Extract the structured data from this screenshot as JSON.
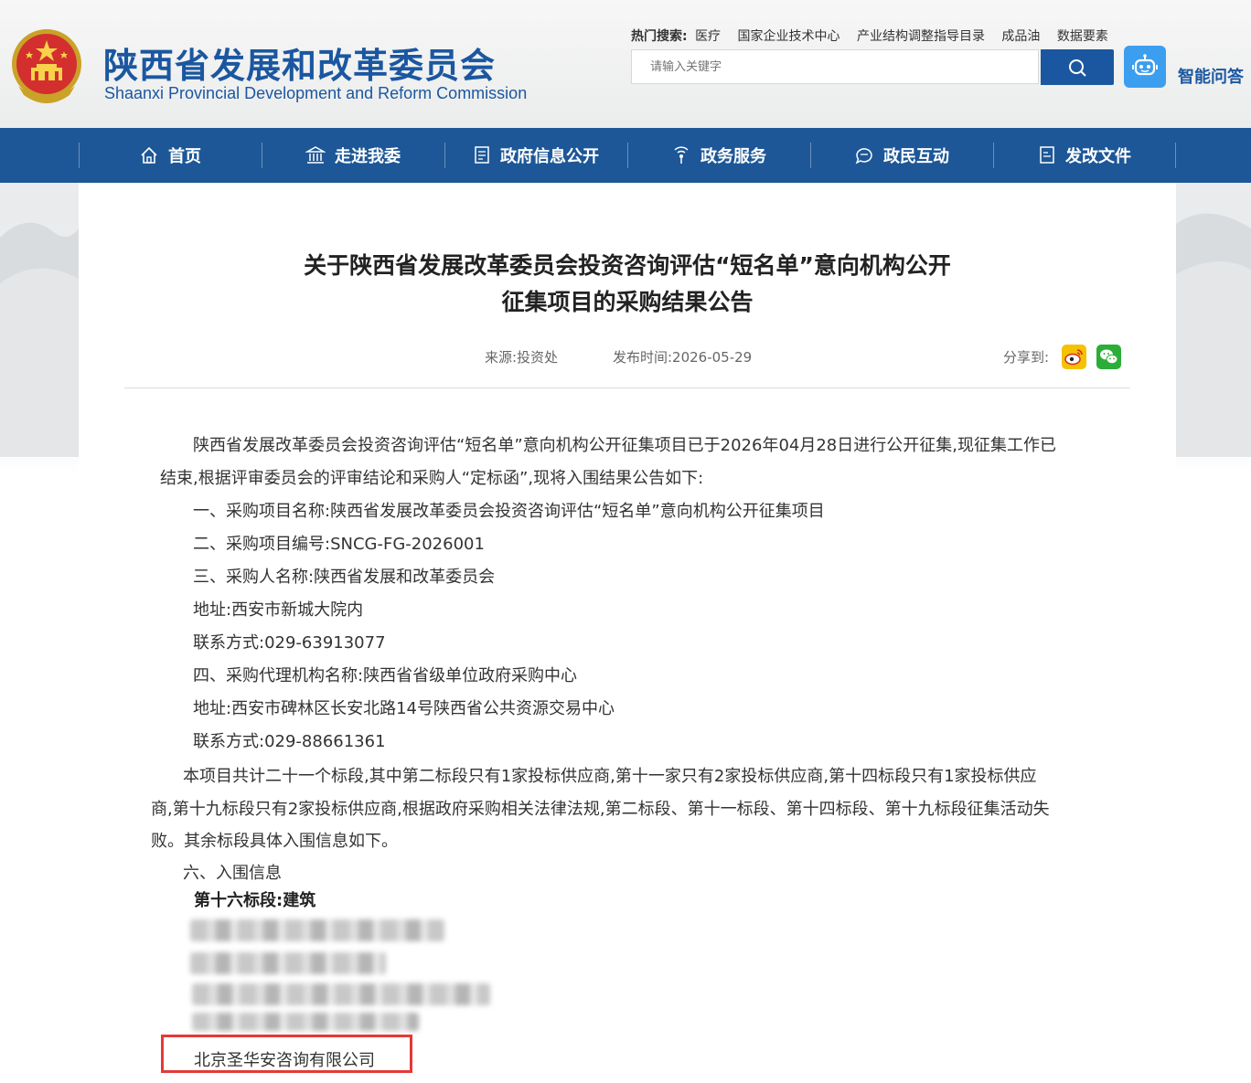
{
  "header": {
    "title_cn": "陕西省发展和改革委员会",
    "title_en": "Shaanxi Provincial Development and Reform Commission",
    "emblem_icon": "national-emblem-icon",
    "hot_search_label": "热门搜索:",
    "hot_search_items": [
      "医疗",
      "国家企业技术中心",
      "产业结构调整指导目录",
      "成品油",
      "数据要素"
    ],
    "search_placeholder": "请输入关键字",
    "smart_qa_label": "智能问答"
  },
  "nav": {
    "items": [
      {
        "label": "首页",
        "icon": "home-icon"
      },
      {
        "label": "走进我委",
        "icon": "building-icon"
      },
      {
        "label": "政府信息公开",
        "icon": "document-icon"
      },
      {
        "label": "政务服务",
        "icon": "signal-icon"
      },
      {
        "label": "政民互动",
        "icon": "chat-icon"
      },
      {
        "label": "发改文件",
        "icon": "file-icon"
      }
    ]
  },
  "article": {
    "title_line1": "关于陕西省发展改革委员会投资咨询评估“短名单”意向机构公开",
    "title_line2": "征集项目的采购结果公告",
    "source": "来源:投资处",
    "publish_time": "发布时间:2026-05-29",
    "share_label": "分享到:",
    "share_icons": [
      "weibo-icon",
      "wechat-icon"
    ],
    "intro_line1": "陕西省发展改革委员会投资咨询评估“短名单”意向机构公开征集项目已于2026年04月28日进行公开征集,现征集工作已",
    "intro_line2": "结束,根据评审委员会的评审结论和采购人“定标函”,现将入围结果公告如下:",
    "item1": "一、采购项目名称:陕西省发展改革委员会投资咨询评估“短名单”意向机构公开征集项目",
    "item2": "二、采购项目编号:SNCG-FG-2026001",
    "item3": "三、采购人名称:陕西省发展和改革委员会",
    "item3_address": "地址:西安市新城大院内",
    "item3_contact": "联系方式:029-63913077",
    "item4": "四、采购代理机构名称:陕西省省级单位政府采购中心",
    "item4_address": "地址:西安市碑林区长安北路14号陕西省公共资源交易中心",
    "item4_contact": "联系方式:029-88661361",
    "summary_line1": "本项目共计二十一个标段,其中第二标段只有1家投标供应商,第十一家只有2家投标供应商,第十四标段只有1家投标供应",
    "summary_line2": "商,第十九标段只有2家投标供应商,根据政府采购相关法律法规,第二标段、第十一标段、第十四标段、第十九标段征集活动失",
    "summary_line3": "败。其余标段具体入围信息如下。",
    "item6": "六、入围信息",
    "section_heading": "第十六标段:建筑",
    "highlighted_company": "北京圣华安咨询有限公司"
  }
}
